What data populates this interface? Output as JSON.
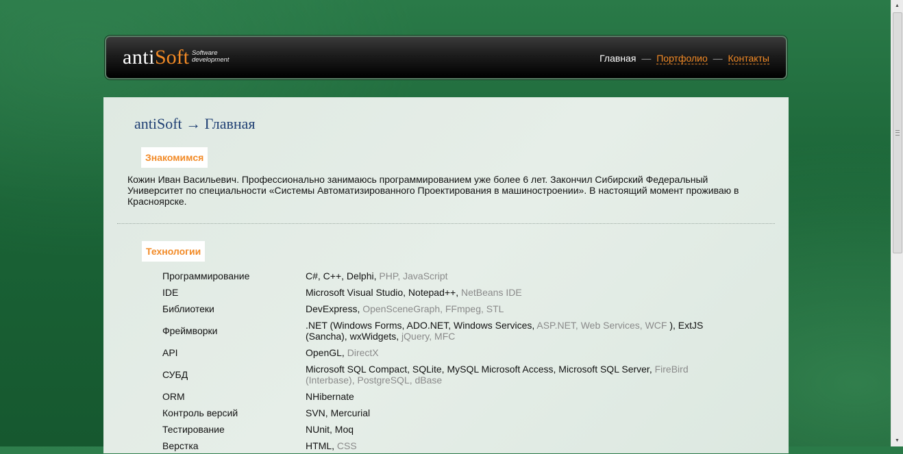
{
  "header": {
    "logo": {
      "anti": "anti",
      "soft": "Soft",
      "tagline": "Software development"
    },
    "nav": {
      "home": "Главная",
      "sep1": "—",
      "portfolio": "Портфолио",
      "sep2": "—",
      "contacts": "Контакты"
    }
  },
  "page": {
    "title": "antiSoft → Главная"
  },
  "intro": {
    "heading": "Знакомимся",
    "text": "Кожин Иван Васильевич. Профессионально занимаюсь программированием уже более 6 лет. Закончил Сибирский Федеральный Университет по специальности «Системы Автоматизированного Проектирования в машиностроении». В настоящий момент проживаю в Красноярске."
  },
  "tech": {
    "heading": "Технологии",
    "rows": [
      {
        "key": "Программирование",
        "main": "C#, C++, Delphi,",
        "muted": " PHP, JavaScript"
      },
      {
        "key": "IDE",
        "main": "Microsoft Visual Studio, Notepad++,",
        "muted": " NetBeans IDE"
      },
      {
        "key": "Библиотеки",
        "main": "DevExpress,",
        "muted": " OpenSceneGraph, FFmpeg, STL"
      },
      {
        "key": "Фреймворки",
        "main": ".NET (Windows Forms, ADO.NET, Windows Services,",
        "muted": " ASP.NET, Web Services, WCF",
        "main2": " ), ExtJS (Sancha), wxWidgets,",
        "muted2": " jQuery, MFC"
      },
      {
        "key": "API",
        "main": "OpenGL,",
        "muted": " DirectX"
      },
      {
        "key": "СУБД",
        "main": "Microsoft SQL Compact, SQLite, MySQL Microsoft Access, Microsoft SQL Server,",
        "muted": " FireBird (Interbase), PostgreSQL, dBase"
      },
      {
        "key": "ORM",
        "main": "NHibernate",
        "muted": ""
      },
      {
        "key": "Контроль версий",
        "main": "SVN, Mercurial",
        "muted": ""
      },
      {
        "key": "Тестирование",
        "main": "NUnit, Moq",
        "muted": ""
      },
      {
        "key": "Верстка",
        "main": "HTML,",
        "muted": " CSS"
      }
    ]
  },
  "colors": {
    "accent": "#f28a26",
    "title": "#1f3f73",
    "muted": "#8a8a8a",
    "background": "#1a6336"
  }
}
